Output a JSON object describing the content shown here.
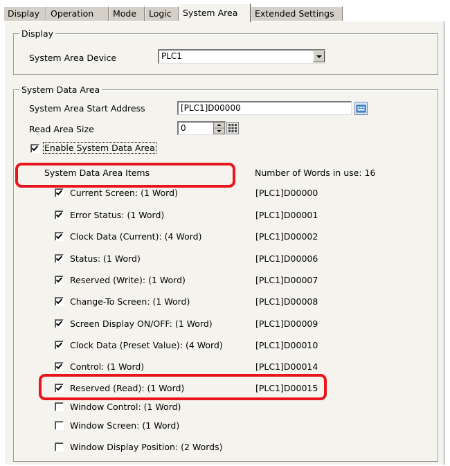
{
  "tabs": [
    {
      "label": "Display",
      "active": false
    },
    {
      "label": "Operation",
      "active": false
    },
    {
      "label": "Mode",
      "active": false
    },
    {
      "label": "Logic",
      "active": false
    },
    {
      "label": "System Area",
      "active": true
    },
    {
      "label": "Extended Settings",
      "active": false
    }
  ],
  "display_group": {
    "title": "Display",
    "device_label": "System Area Device",
    "device_value": "PLC1"
  },
  "system_data_group": {
    "title": "System Data Area",
    "start_address_label": "System Area Start Address",
    "start_address_value": "[PLC1]D00000",
    "read_size_label": "Read Area Size",
    "read_size_value": "0",
    "enable_label": "Enable System Data Area",
    "enable_checked": true,
    "items_header": "System Data Area Items",
    "words_in_use": "Number of Words in use: 16"
  },
  "items": [
    {
      "label": "Current Screen: (1 Word)",
      "address": "[PLC1]D00000",
      "checked": true
    },
    {
      "label": "Error Status: (1 Word)",
      "address": "[PLC1]D00001",
      "checked": true
    },
    {
      "label": "Clock Data (Current): (4 Word)",
      "address": "[PLC1]D00002",
      "checked": true
    },
    {
      "label": "Status: (1 Word)",
      "address": "[PLC1]D00006",
      "checked": true
    },
    {
      "label": "Reserved (Write): (1 Word)",
      "address": "[PLC1]D00007",
      "checked": true
    },
    {
      "label": "Change-To Screen: (1 Word)",
      "address": "[PLC1]D00008",
      "checked": true
    },
    {
      "label": "Screen Display ON/OFF: (1 Word)",
      "address": "[PLC1]D00009",
      "checked": true
    },
    {
      "label": "Clock Data (Preset Value): (4 Word)",
      "address": "[PLC1]D00010",
      "checked": true
    },
    {
      "label": "Control: (1 Word)",
      "address": "[PLC1]D00014",
      "checked": true
    },
    {
      "label": "Reserved (Read): (1 Word)",
      "address": "[PLC1]D00015",
      "checked": true
    },
    {
      "label": "Window Control: (1 Word)",
      "address": "",
      "checked": false
    },
    {
      "label": "Window Screen: (1 Word)",
      "address": "",
      "checked": false
    },
    {
      "label": "Window Display Position: (2 Words)",
      "address": "",
      "checked": false
    }
  ],
  "highlight_color": "#e8161c"
}
